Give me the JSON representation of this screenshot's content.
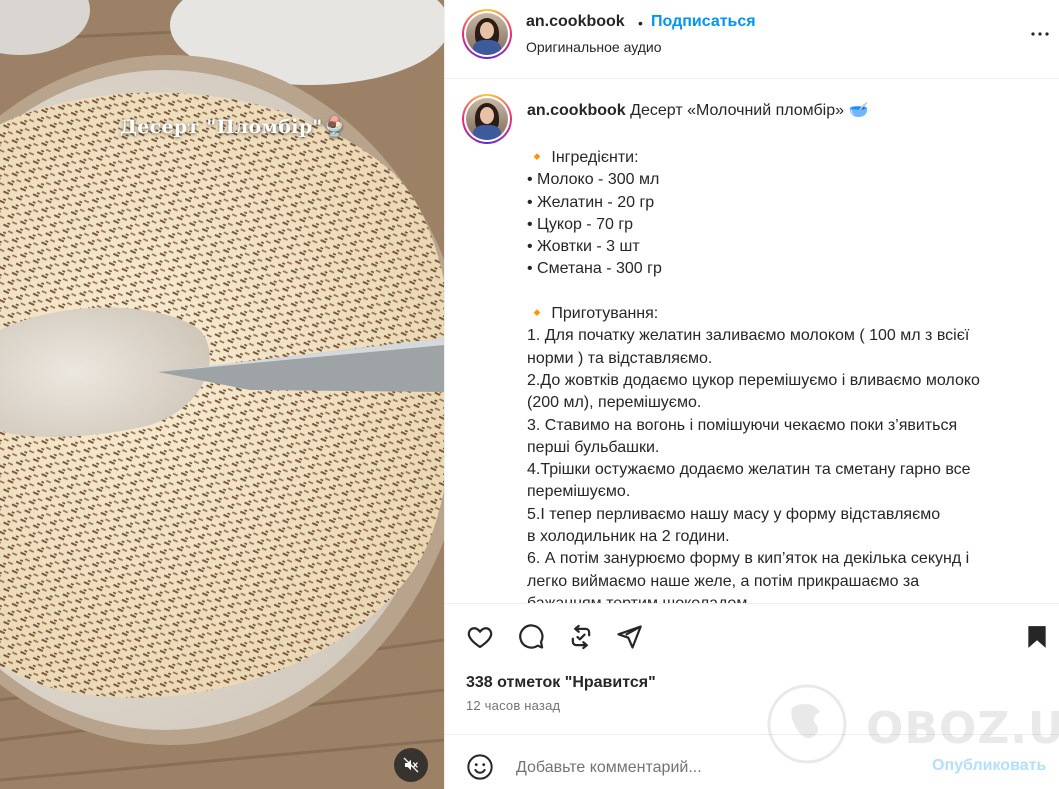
{
  "media": {
    "overlay_text": "Десерт \"Пломбір\"🍨",
    "mute_icon": "speaker-muted-icon"
  },
  "header": {
    "username": "an.cookbook",
    "separator": "•",
    "follow_label": "Подписаться",
    "audio_label": "Оригинальное аудио",
    "more_icon": "more-horizontal-icon"
  },
  "caption": {
    "username": "an.cookbook",
    "title": "Десерт «Молочний пломбір» 🥣",
    "lines": [
      "🔸 Інгредієнти:",
      "• Молоко - 300 мл",
      "• Желатин - 20 гр",
      "• Цукор - 70 гр",
      "• Жовтки - 3 шт",
      "• Сметана - 300 гр",
      "",
      "🔸 Приготування:",
      "1. Для початку желатин заливаємо молоком ( 100 мл з всієї",
      "норми ) та відставляємо.",
      "2.До жовтків додаємо цукор перемішуємо і вливаємо молоко",
      "(200 мл), перемішуємо.",
      "3. Ставимо на вогонь і помішуючи чекаємо поки з’явиться",
      "перші бульбашки.",
      "4.Трішки остужаємо додаємо желатин та сметану гарно все",
      "перемішуємо.",
      "5.І тепер перливаємо нашу масу у форму відставляємо",
      "в холодильник на 2 години.",
      "6. А потім занурюємо форму в кип’яток на декілька секунд і",
      "легко виймаємо наше желе, а потім прикрашаємо за",
      "бажанням тертим шоколадом."
    ]
  },
  "actions": {
    "icons": [
      "heart-icon",
      "comment-icon",
      "repost-icon",
      "share-icon",
      "bookmark-icon"
    ]
  },
  "stats": {
    "likes": "338 отметок \"Нравится\"",
    "time": "12 часов назад"
  },
  "comment": {
    "placeholder": "Добавьте комментарий...",
    "publish_label": "Опубликовать",
    "emoji_icon": "emoji-icon"
  },
  "watermark": {
    "text": "OBOZ.UA"
  },
  "colors": {
    "accent": "#0095f6",
    "publish_disabled": "#b2dffc",
    "text": "#262626",
    "secondary": "#737373",
    "divider": "#efefef"
  }
}
